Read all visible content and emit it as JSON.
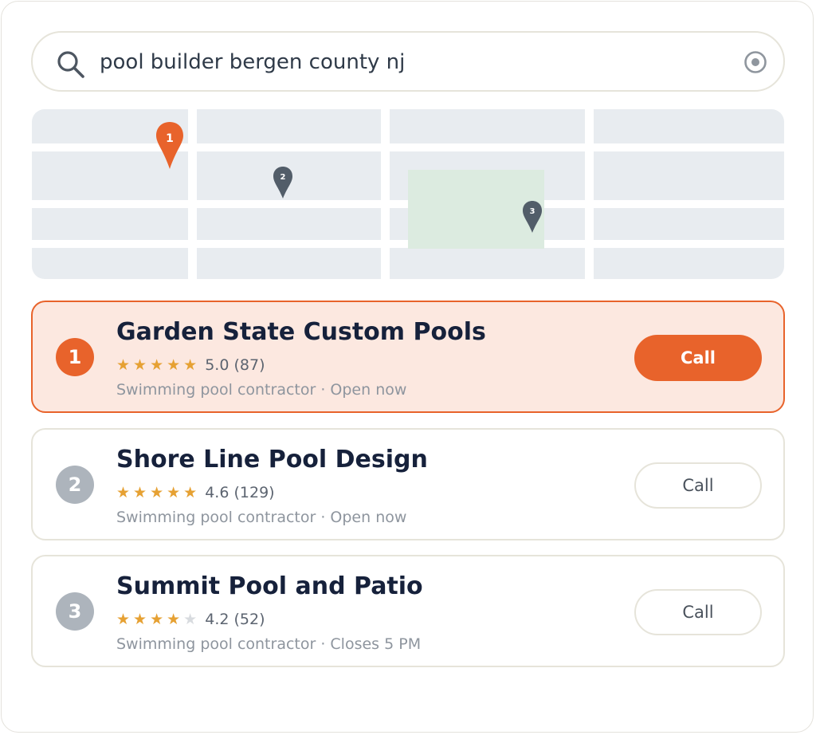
{
  "search": {
    "query": "pool builder bergen county nj",
    "icon": "search-icon",
    "locate_icon": "locate-icon"
  },
  "map": {
    "pins": [
      {
        "label": "1",
        "selected": true
      },
      {
        "label": "2",
        "selected": false
      },
      {
        "label": "3",
        "selected": false
      }
    ]
  },
  "results": [
    {
      "rank": "1",
      "name": "Garden State Custom Pools",
      "rating": 5.0,
      "rating_text": "5.0 (87)",
      "meta": "Swimming pool contractor · Open now",
      "call_label": "Call",
      "selected": true
    },
    {
      "rank": "2",
      "name": "Shore Line Pool Design",
      "rating": 4.6,
      "rating_text": "4.6 (129)",
      "meta": "Swimming pool contractor · Open now",
      "call_label": "Call",
      "selected": false
    },
    {
      "rank": "3",
      "name": "Summit Pool and Patio",
      "rating": 4.2,
      "rating_text": "4.2 (52)",
      "meta": "Swimming pool contractor · Closes 5 PM",
      "call_label": "Call",
      "selected": false
    }
  ],
  "colors": {
    "accent": "#e8632b",
    "star": "#e6a133",
    "map_block": "#e8ecf0",
    "park": "#dcebe0",
    "pin_inactive": "#525d69"
  }
}
